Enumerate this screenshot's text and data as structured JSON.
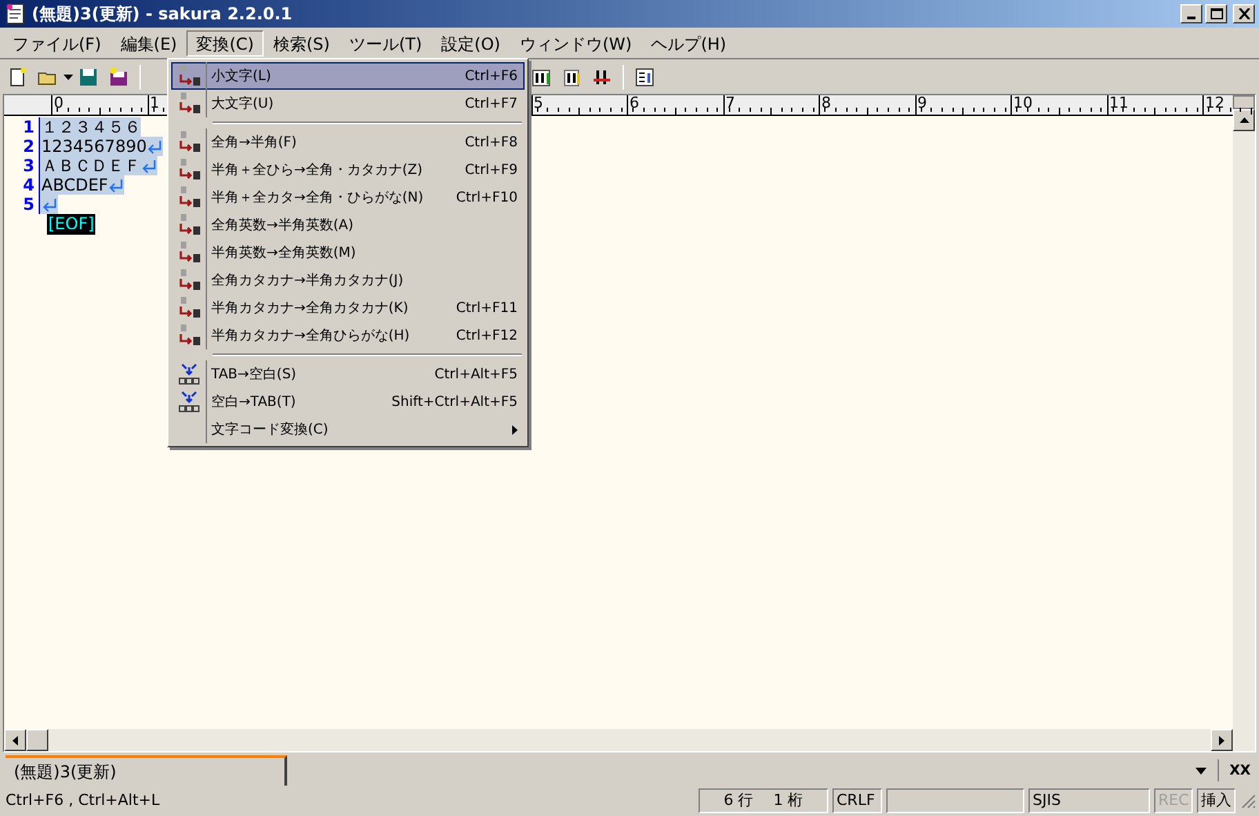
{
  "window": {
    "title": "(無題)3(更新) - sakura 2.2.0.1"
  },
  "menubar": [
    {
      "label": "ファイル(F)",
      "selected": false
    },
    {
      "label": "編集(E)",
      "selected": false
    },
    {
      "label": "変換(C)",
      "selected": true
    },
    {
      "label": "検索(S)",
      "selected": false
    },
    {
      "label": "ツール(T)",
      "selected": false
    },
    {
      "label": "設定(O)",
      "selected": false
    },
    {
      "label": "ウィンドウ(W)",
      "selected": false
    },
    {
      "label": "ヘルプ(H)",
      "selected": false
    }
  ],
  "ruler": {
    "labels": [
      "0",
      "1",
      "5",
      "6",
      "7",
      "8",
      "9",
      "10",
      "11",
      "12"
    ]
  },
  "editor": {
    "lines": [
      {
        "number": "1",
        "text": "１２３４５６",
        "eol": false
      },
      {
        "number": "2",
        "text": "1234567890",
        "eol": true
      },
      {
        "number": "3",
        "text": "ＡＢＣＤＥＦ",
        "eol": true
      },
      {
        "number": "4",
        "text": "ABCDEF",
        "eol": true
      },
      {
        "number": "5",
        "eol": true
      }
    ],
    "eof": "[EOF]"
  },
  "menu": [
    {
      "kind": "convert",
      "label": "小文字(L)",
      "shortcut": "Ctrl+F6",
      "selected": true
    },
    {
      "kind": "convert",
      "label": "大文字(U)",
      "shortcut": "Ctrl+F7",
      "selected": false
    },
    {
      "kind": "separator"
    },
    {
      "kind": "convert",
      "label": "全角→半角(F)",
      "shortcut": "Ctrl+F8",
      "selected": false
    },
    {
      "kind": "convert",
      "label": "半角＋全ひら→全角・カタカナ(Z)",
      "shortcut": "Ctrl+F9",
      "selected": false
    },
    {
      "kind": "convert",
      "label": "半角＋全カタ→全角・ひらがな(N)",
      "shortcut": "Ctrl+F10",
      "selected": false
    },
    {
      "kind": "convert",
      "label": "全角英数→半角英数(A)",
      "selected": false
    },
    {
      "kind": "convert",
      "label": "半角英数→全角英数(M)",
      "selected": false
    },
    {
      "kind": "convert",
      "label": "全角カタカナ→半角カタカナ(J)",
      "selected": false
    },
    {
      "kind": "convert",
      "label": "半角カタカナ→全角カタカナ(K)",
      "shortcut": "Ctrl+F11",
      "selected": false
    },
    {
      "kind": "convert",
      "label": "半角カタカナ→全角ひらがな(H)",
      "shortcut": "Ctrl+F12",
      "selected": false
    },
    {
      "kind": "separator"
    },
    {
      "kind": "spacing",
      "label": "TAB→空白(S)",
      "shortcut": "Ctrl+Alt+F5",
      "selected": false
    },
    {
      "kind": "spacing",
      "label": "空白→TAB(T)",
      "shortcut": "Shift+Ctrl+Alt+F5",
      "selected": false
    },
    {
      "kind": "submenu",
      "label": "文字コード変換(C)",
      "selected": false
    }
  ],
  "tabs": [
    {
      "label": "(無題)3(更新)",
      "selected": true
    }
  ],
  "tab_close": "XX",
  "status_bar": {
    "message": "Ctrl+F6 , Ctrl+Alt+L",
    "fields": [
      {
        "text": "6 行　 1 桁",
        "disabled": false
      },
      {
        "text": "CRLF",
        "disabled": false
      },
      {
        "text": "SJIS",
        "disabled": false
      },
      {
        "text": "REC",
        "disabled": true
      },
      {
        "text": "挿入",
        "disabled": false
      }
    ]
  }
}
